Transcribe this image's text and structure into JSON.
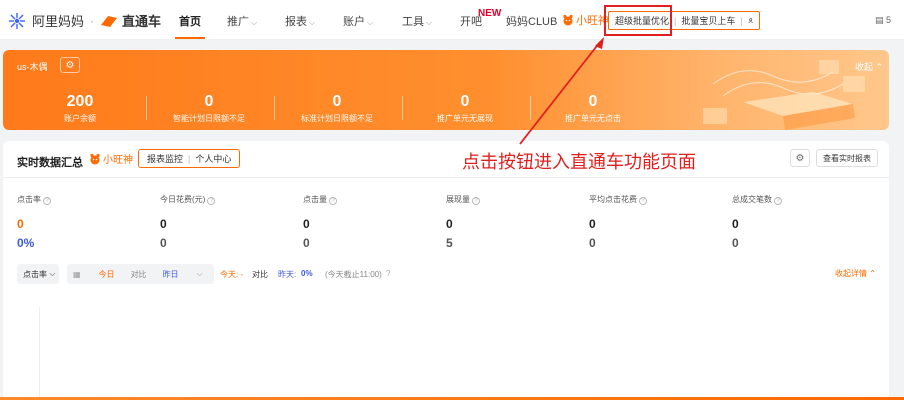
{
  "nav": {
    "brand1": "阿里妈妈",
    "brand_dot": "·",
    "brand2": "直通车",
    "items": [
      {
        "label": "首页",
        "caret": ""
      },
      {
        "label": "推广",
        "caret": "⌵"
      },
      {
        "label": "报表",
        "caret": "⌵"
      },
      {
        "label": "账户",
        "caret": "⌵"
      },
      {
        "label": "工具",
        "caret": "⌵"
      },
      {
        "label": "开吧",
        "caret": ""
      },
      {
        "label": "妈妈CLUB",
        "caret": ""
      }
    ],
    "new_badge": "NEW",
    "xiaowangshen": "小旺神",
    "btn_batch": "超级批量优化",
    "btn_sep": "|",
    "btn_upload": "批量宝贝上车",
    "right_count": "5"
  },
  "banner": {
    "account": "us-木偶",
    "collapse": "收起",
    "metrics": [
      {
        "value": "200",
        "label": "账户余额"
      },
      {
        "value": "0",
        "label": "智能计划日限额不足"
      },
      {
        "value": "0",
        "label": "标准计划日限额不足"
      },
      {
        "value": "0",
        "label": "推广单元无展现"
      },
      {
        "value": "0",
        "label": "推广单元无点击"
      }
    ]
  },
  "annotation": "点击按钮进入直通车功能页面",
  "card": {
    "title": "实时数据汇总",
    "xiaowangshen": "小旺神",
    "btn_report": "报表监控",
    "btn_sep": "|",
    "btn_personal": "个人中心",
    "btn_view": "查看实时报表",
    "columns": [
      {
        "header": "点击率",
        "today": "0",
        "compare": "0%"
      },
      {
        "header": "今日花费(元)",
        "today": "0",
        "compare": "0"
      },
      {
        "header": "点击量",
        "today": "0",
        "compare": "0"
      },
      {
        "header": "展现量",
        "today": "0",
        "compare": "5"
      },
      {
        "header": "平均点击花费",
        "today": "0",
        "compare": "0"
      },
      {
        "header": "总成交笔数",
        "today": "0",
        "compare": "0"
      }
    ],
    "controls": {
      "metric_select": "点击率",
      "today": "今日",
      "compare": "对比",
      "yesterday": "昨日",
      "legend_today": "今天: -",
      "legend_compare": "对比",
      "legend_yesterday": "昨天:",
      "legend_yesterday_val": "0%",
      "legend_note": "(今天截止11:00)",
      "detail": "收起详情"
    }
  },
  "colors": {
    "accent": "#ff6a00",
    "annotation": "#e0201e",
    "blue_value": "#3d5bd8"
  }
}
